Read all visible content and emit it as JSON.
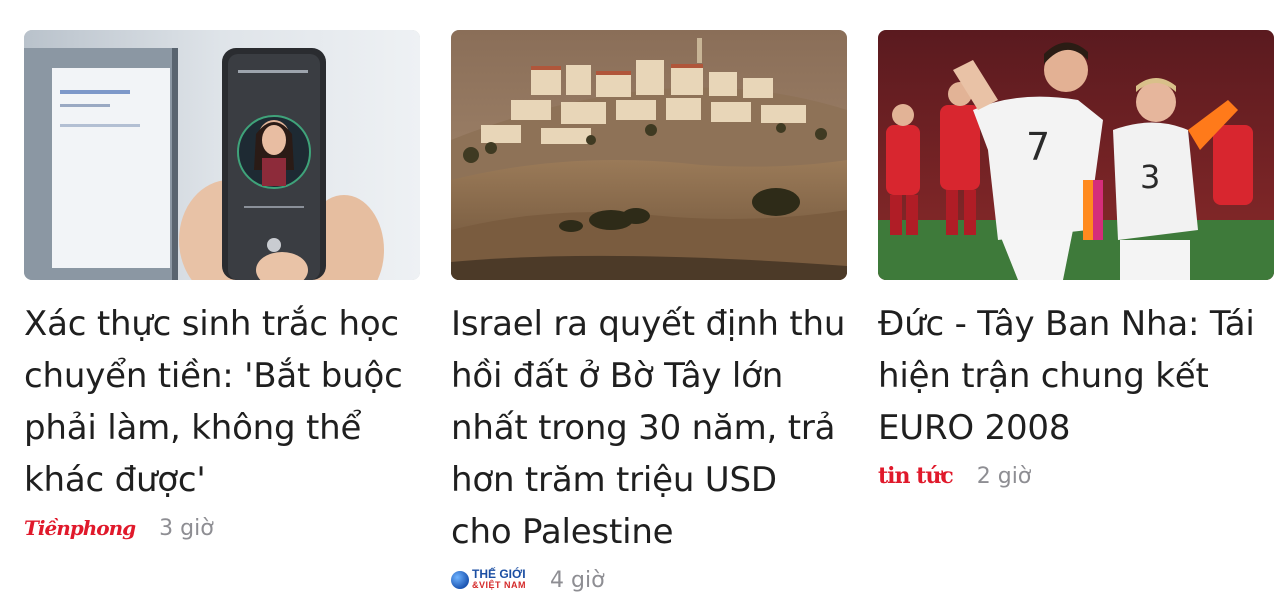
{
  "articles": [
    {
      "headline": "Xác thực sinh trắc học chuyển tiền: 'Bắt buộc phải làm, không thể khác được'",
      "source": "Tiềnphong",
      "age": "3 giờ",
      "image": "phone-face-verification"
    },
    {
      "headline": "Israel ra quyết định thu hồi đất ở Bờ Tây lớn nhất trong 30 năm, trả hơn trăm triệu USD cho Palestine",
      "source_line1": "THẾ GIỚI",
      "source_line2": "&VIỆT NAM",
      "age": "4 giờ",
      "image": "west-bank-settlement"
    },
    {
      "headline": "Đức - Tây Ban Nha: Tái hiện trận chung kết EURO 2008",
      "source": "tin tức",
      "age": "2 giờ",
      "image": "germany-football-celebration"
    }
  ]
}
